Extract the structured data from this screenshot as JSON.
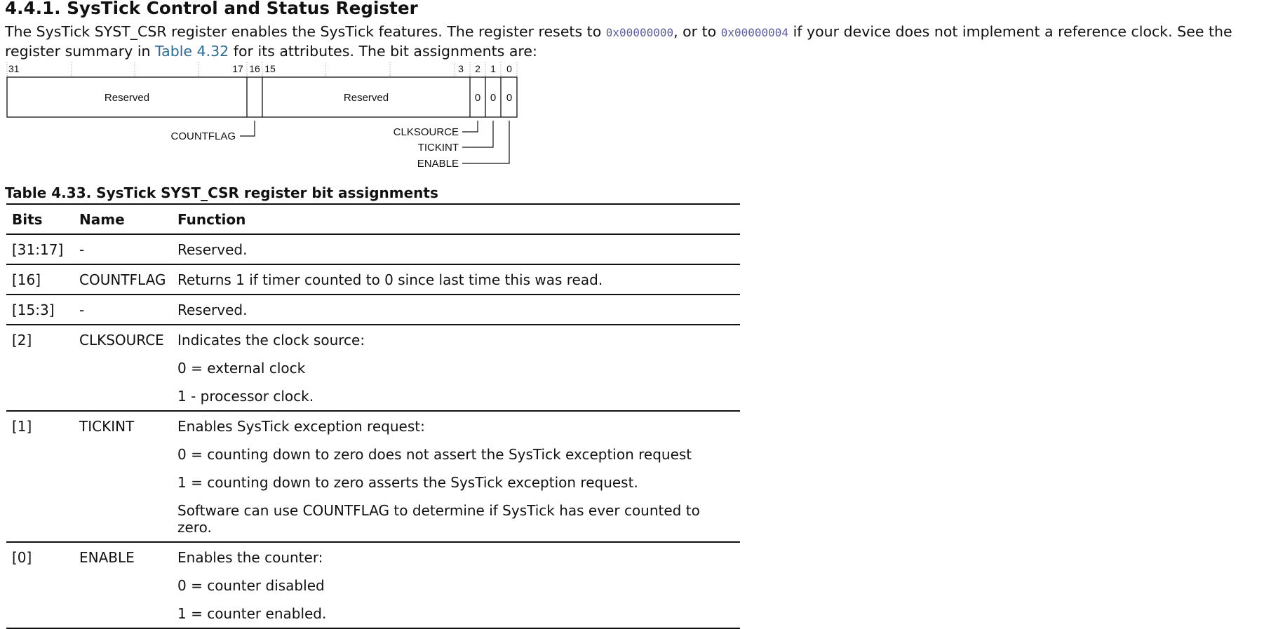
{
  "section": {
    "heading": "4.4.1. SysTick Control and Status Register",
    "intro": {
      "p1": "The SysTick SYST_CSR register enables the SysTick features. The register resets to ",
      "reset_value": "0x00000000",
      "p2": ", or to ",
      "alt_value": "0x00000004",
      "p3": " if your device does not implement a reference clock. See the register summary in ",
      "xref": "Table 4.32",
      "p4": " for its attributes. The bit assignments are:"
    }
  },
  "diagram": {
    "bit_numbers": {
      "b31": "31",
      "b17": "17",
      "b16": "16",
      "b15": "15",
      "b3": "3",
      "b2": "2",
      "b1": "1",
      "b0": "0"
    },
    "fields": {
      "reserved_high": "Reserved",
      "reserved_low": "Reserved",
      "bit2_value": "0",
      "bit1_value": "0",
      "bit0_value": "0"
    },
    "callouts": {
      "countflag": "COUNTFLAG",
      "clksource": "CLKSOURCE",
      "tickint": "TICKINT",
      "enable": "ENABLE"
    }
  },
  "table": {
    "caption": "Table 4.33. SysTick SYST_CSR register bit assignments",
    "headers": {
      "bits": "Bits",
      "name": "Name",
      "function": "Function"
    },
    "rows": [
      {
        "bits": "[31:17]",
        "name": "-",
        "function": [
          "Reserved."
        ]
      },
      {
        "bits": "[16]",
        "name": "COUNTFLAG",
        "function": [
          "Returns 1 if timer counted to 0 since last time this was read."
        ]
      },
      {
        "bits": "[15:3]",
        "name": "-",
        "function": [
          "Reserved."
        ]
      },
      {
        "bits": "[2]",
        "name": "CLKSOURCE",
        "function": [
          "Indicates the clock source:",
          "0 = external clock",
          "1 - processor clock."
        ]
      },
      {
        "bits": "[1]",
        "name": "TICKINT",
        "function": [
          "Enables SysTick exception request:",
          "0 = counting down to zero does not assert the SysTick exception request",
          "1 = counting down to zero asserts the SysTick exception request.",
          "Software can use COUNTFLAG to determine if SysTick has ever counted to zero."
        ]
      },
      {
        "bits": "[0]",
        "name": "ENABLE",
        "function": [
          "Enables the counter:",
          "0 = counter disabled",
          "1 = counter enabled."
        ]
      }
    ]
  }
}
